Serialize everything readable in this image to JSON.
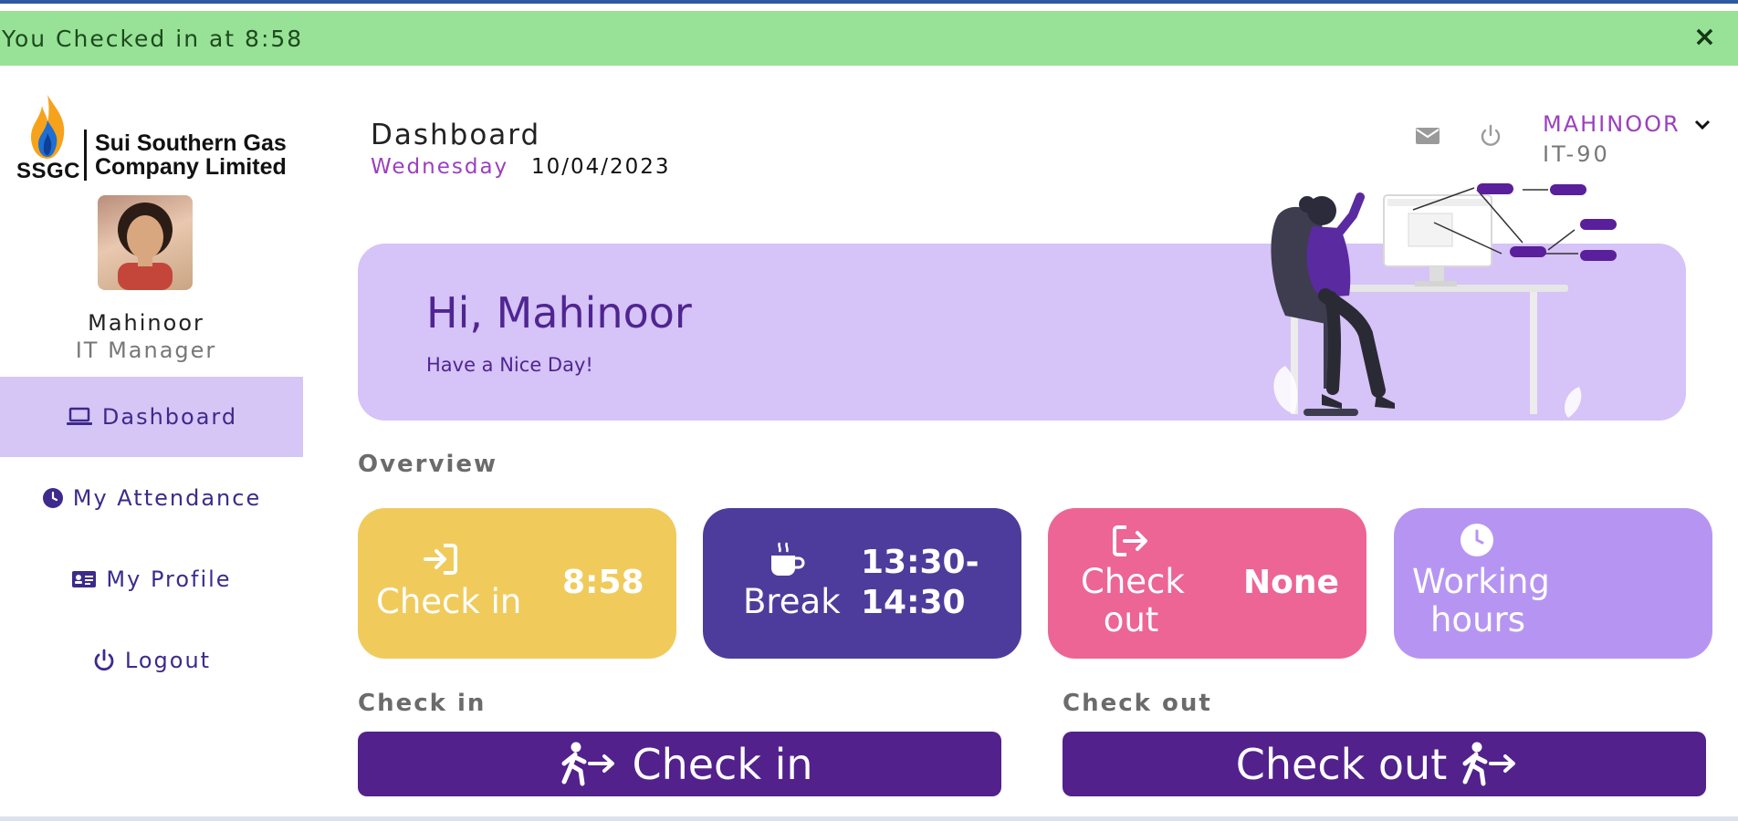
{
  "alert": {
    "message": "You Checked in at 8:58",
    "close_label": "×"
  },
  "logo": {
    "abbr": "SSGC",
    "name_line1": "Sui Southern Gas",
    "name_line2": "Company Limited"
  },
  "user": {
    "name": "Mahinoor",
    "role": "IT Manager",
    "menu_name": "MAHINOOR",
    "code": "IT-90"
  },
  "nav": {
    "items": [
      {
        "label": "Dashboard",
        "icon": "laptop-icon",
        "active": true
      },
      {
        "label": "My Attendance",
        "icon": "clock-icon",
        "active": false
      },
      {
        "label": "My Profile",
        "icon": "id-card-icon",
        "active": false
      },
      {
        "label": "Logout",
        "icon": "power-icon",
        "active": false
      }
    ]
  },
  "header": {
    "title": "Dashboard",
    "day": "Wednesday",
    "date": "10/04/2023"
  },
  "banner": {
    "greeting": "Hi, Mahinoor",
    "subtitle": "Have a Nice Day!"
  },
  "overview": {
    "label": "Overview",
    "cards": [
      {
        "label": "Check in",
        "value": "8:58",
        "icon": "sign-in-icon",
        "color": "#f0cb5c"
      },
      {
        "label": "Break",
        "value_line1": "13:30-",
        "value_line2": "14:30",
        "icon": "coffee-icon",
        "color": "#4d3c9b"
      },
      {
        "label_line1": "Check",
        "label_line2": "out",
        "value": "None",
        "icon": "sign-out-icon",
        "color": "#ec6595"
      },
      {
        "label_line1": "Working",
        "label_line2": "hours",
        "value": "",
        "icon": "clock-icon",
        "color": "#b695f2"
      }
    ]
  },
  "actions": {
    "checkin_label": "Check in",
    "checkout_label": "Check out",
    "checkin_button": "Check in",
    "checkout_button": "Check out",
    "button_color": "#52218c"
  },
  "colors": {
    "alert_bg": "#98e298",
    "accent": "#9b3fbf",
    "nav_active": "#d6c6f5",
    "banner": "#d6c3f7"
  }
}
